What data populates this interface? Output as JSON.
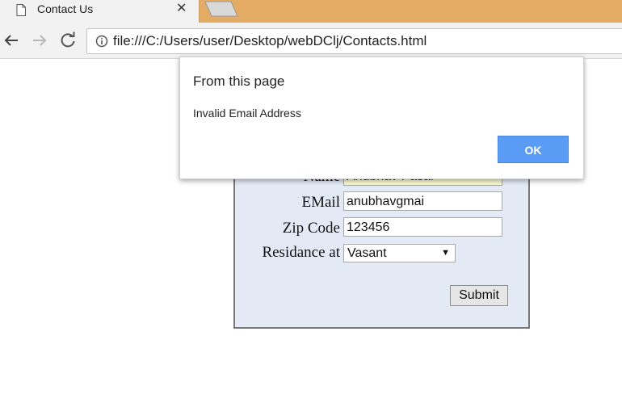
{
  "tab": {
    "title": "Contact Us",
    "close_glyph": "✕"
  },
  "toolbar": {
    "url": "file:///C:/Users/user/Desktop/webDClj/Contacts.html"
  },
  "form": {
    "name_label": "Name",
    "name_value": "Anubhav Pasal",
    "email_label": "EMail",
    "email_value": "anubhavgmai",
    "zip_label": "Zip Code",
    "zip_value": "123456",
    "residence_label": "Residance at",
    "residence_selected": "Vasant",
    "select_arrow": "▼",
    "submit_label": "Submit"
  },
  "dialog": {
    "title": "From this page",
    "message": "Invalid Email Address",
    "ok_label": "OK"
  },
  "colors": {
    "tabstrip": "#e4ab64",
    "form_bg": "#e3eaf5",
    "ok_button": "#5a9bf5"
  },
  "icons": [
    "page-icon",
    "close-icon",
    "back-icon",
    "forward-icon",
    "reload-icon",
    "info-icon",
    "dropdown-arrow-icon"
  ]
}
